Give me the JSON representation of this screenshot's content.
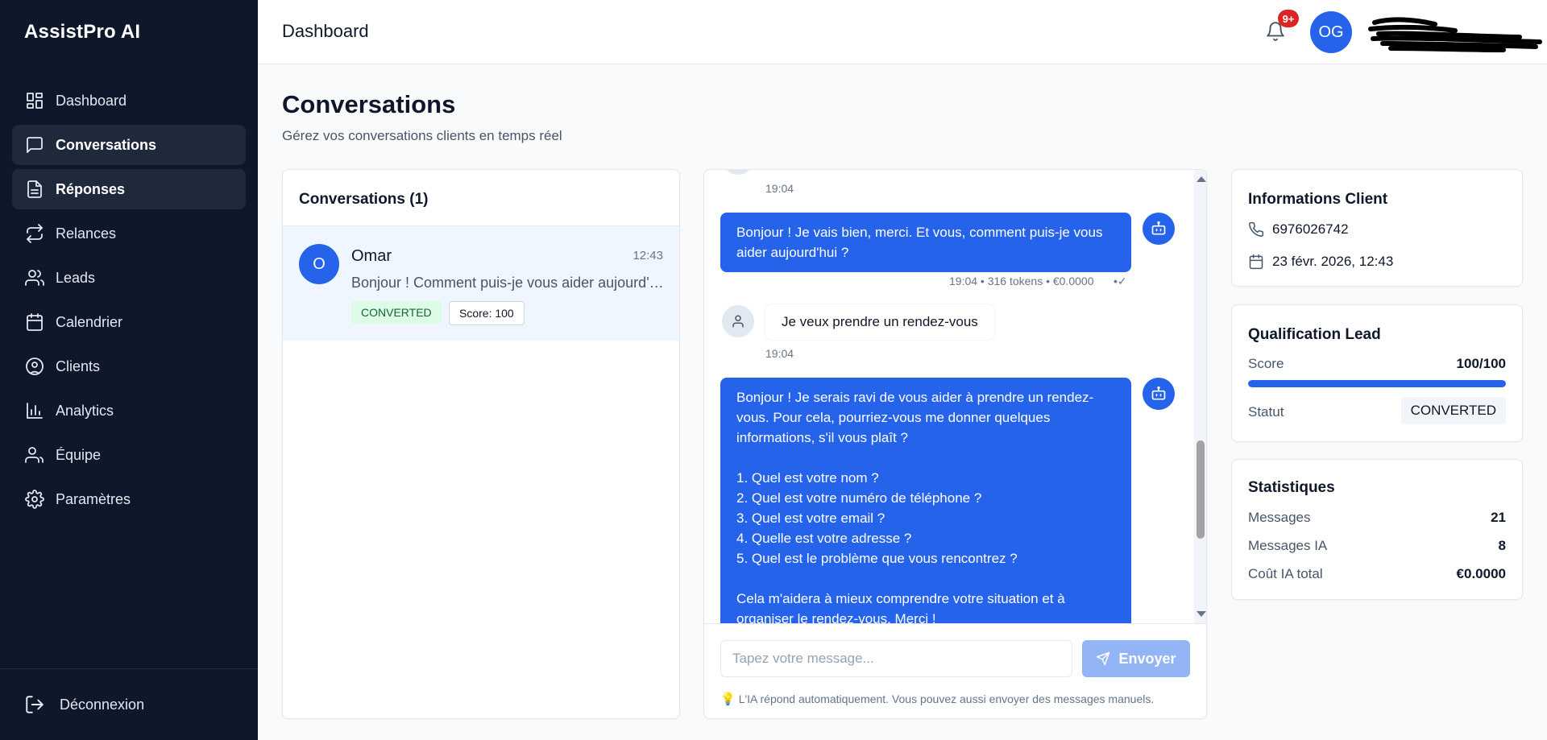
{
  "brand": "AssistPro AI",
  "sidebar": {
    "items": [
      {
        "label": "Dashboard",
        "icon": "dashboard-icon"
      },
      {
        "label": "Conversations",
        "icon": "message-square-icon"
      },
      {
        "label": "Réponses",
        "icon": "file-text-icon"
      },
      {
        "label": "Relances",
        "icon": "repeat-icon"
      },
      {
        "label": "Leads",
        "icon": "users-icon"
      },
      {
        "label": "Calendrier",
        "icon": "calendar-icon"
      },
      {
        "label": "Clients",
        "icon": "user-circle-icon"
      },
      {
        "label": "Analytics",
        "icon": "bar-chart-icon"
      },
      {
        "label": "Équipe",
        "icon": "team-icon"
      },
      {
        "label": "Paramètres",
        "icon": "gear-icon"
      }
    ],
    "active": "Conversations",
    "logout_label": "Déconnexion"
  },
  "header": {
    "title": "Dashboard",
    "notification_count": "9+",
    "avatar_initials": "OG"
  },
  "page": {
    "title": "Conversations",
    "subtitle": "Gérez vos conversations clients en temps réel"
  },
  "conversation_list": {
    "header": "Conversations (1)",
    "items": [
      {
        "initial": "O",
        "name": "Omar",
        "time": "12:43",
        "preview": "Bonjour ! Comment puis-je vous aider aujourd'hui ?",
        "status": "CONVERTED",
        "score": "Score: 100"
      }
    ]
  },
  "chat": {
    "messages": {
      "top_timestamp": "19:04",
      "ai_1": "Bonjour ! Je vais bien, merci. Et vous, comment puis-je vous aider aujourd'hui ?",
      "ai_1_meta": "19:04  • 316 tokens • €0.0000",
      "ai_1_check": "•✓",
      "user_1": "Je veux prendre un rendez-vous",
      "user_1_time": "19:04",
      "ai_2": "Bonjour ! Je serais ravi de vous aider à prendre un rendez-vous. Pour cela, pourriez-vous me donner quelques informations, s'il vous plaît ?\n\n1. Quel est votre nom ?\n2. Quel est votre numéro de téléphone ?\n3. Quel est votre email ?\n4. Quelle est votre adresse ?\n5. Quel est le problème que vous rencontrez ?\n\nCela m'aidera à mieux comprendre votre situation et à organiser le rendez-vous. Merci !"
    },
    "input_placeholder": "Tapez votre message...",
    "input_value": "",
    "send_label": "Envoyer",
    "hint": "L'IA répond automatiquement. Vous pouvez aussi envoyer des messages manuels."
  },
  "client_info": {
    "title": "Informations Client",
    "phone": "6976026742",
    "date": "23 févr. 2026, 12:43"
  },
  "qualification": {
    "title": "Qualification Lead",
    "score_label": "Score",
    "score_value": "100/100",
    "score_fraction": 1.0,
    "status_label": "Statut",
    "status_value": "CONVERTED"
  },
  "stats": {
    "title": "Statistiques",
    "rows": [
      {
        "label": "Messages",
        "value": "21"
      },
      {
        "label": "Messages IA",
        "value": "8"
      },
      {
        "label": "Coût IA total",
        "value": "€0.0000"
      }
    ]
  },
  "colors": {
    "sidebar_bg": "#0f172a",
    "accent": "#2563eb",
    "badge_red": "#dc2626",
    "converted_green_bg": "#dcfce7"
  }
}
